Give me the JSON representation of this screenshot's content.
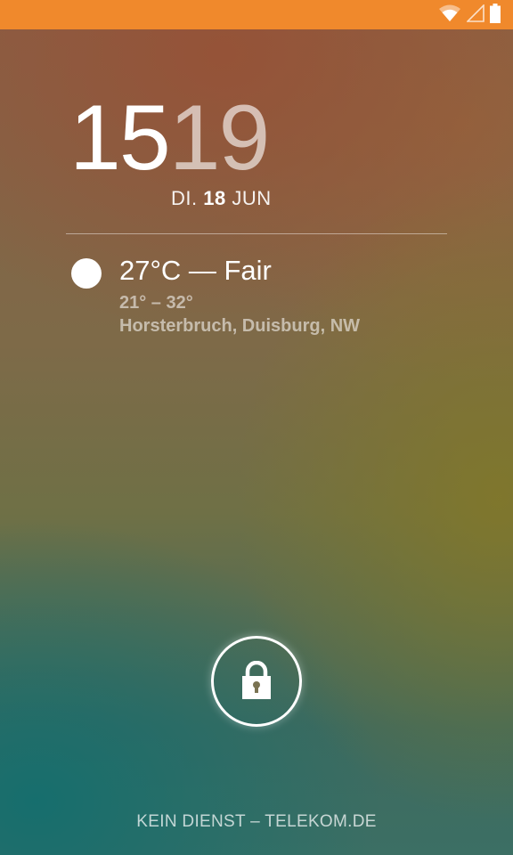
{
  "status_bar": {
    "background_color": "#f0892c",
    "icons": [
      "wifi-icon",
      "signal-icon",
      "battery-icon"
    ]
  },
  "clock": {
    "hours": "15",
    "minutes": "19"
  },
  "date": {
    "weekday": "DI.",
    "day": "18",
    "month": "JUN"
  },
  "weather": {
    "icon": "sun-icon",
    "summary": "27°C — Fair",
    "range": "21° – 32°",
    "location": "Horsterbruch, Duisburg, NW"
  },
  "unlock": {
    "icon": "lock-icon"
  },
  "carrier": {
    "text": "KEIN DIENST – TELEKOM.DE"
  }
}
